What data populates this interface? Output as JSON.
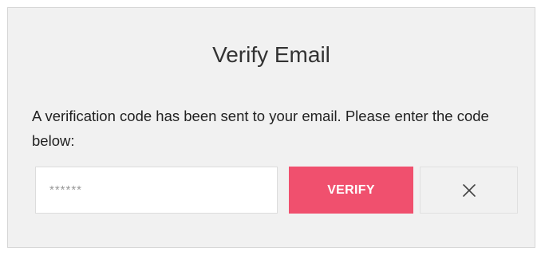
{
  "dialog": {
    "title": "Verify Email",
    "message": "A verification code has been sent to your email. Please enter the code below:",
    "code_input": {
      "value": "",
      "placeholder": "******"
    },
    "verify_label": "VERIFY",
    "close_icon": "close-icon",
    "colors": {
      "accent": "#f0506e",
      "background": "#f1f1f1"
    }
  }
}
